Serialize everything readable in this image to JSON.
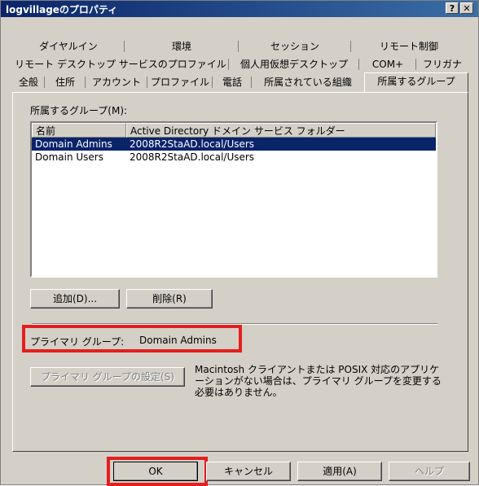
{
  "window": {
    "title": "logvillageのプロパティ",
    "help_button": "?",
    "close_button": "✕"
  },
  "tabs": {
    "row1": [
      "ダイヤルイン",
      "環境",
      "セッション",
      "リモート制御"
    ],
    "row2": [
      "リモート デスクトップ サービスのプロファイル",
      "個人用仮想デスクトップ",
      "COM+",
      "フリガナ"
    ],
    "row3": [
      "全般",
      "住所",
      "アカウント",
      "プロファイル",
      "電話",
      "所属されている組織",
      "所属するグループ"
    ],
    "active": "所属するグループ"
  },
  "groups": {
    "label": "所属するグループ(M):",
    "columns": [
      "名前",
      "Active Directory ドメイン サービス フォルダー"
    ],
    "rows": [
      {
        "name": "Domain Admins",
        "folder": "2008R2StaAD.local/Users",
        "selected": true
      },
      {
        "name": "Domain Users",
        "folder": "2008R2StaAD.local/Users",
        "selected": false
      }
    ],
    "add_button": "追加(D)...",
    "remove_button": "削除(R)"
  },
  "primary": {
    "label": "プライマリ グループ:",
    "value": "Domain Admins",
    "set_button": "プライマリ グループの設定(S)",
    "note": [
      "Macintosh クライアントまたは POSIX 対応のアプリケ",
      "ーションがない場合は、プライマリ グループを変更する",
      "必要はありません。"
    ]
  },
  "footer": {
    "ok": "OK",
    "cancel": "キャンセル",
    "apply": "適用(A)",
    "help": "ヘルプ"
  },
  "colors": {
    "highlight": "#e41e1e",
    "selection": "#0a246a",
    "title_start": "#0a246a",
    "title_end": "#3a6ea5"
  }
}
